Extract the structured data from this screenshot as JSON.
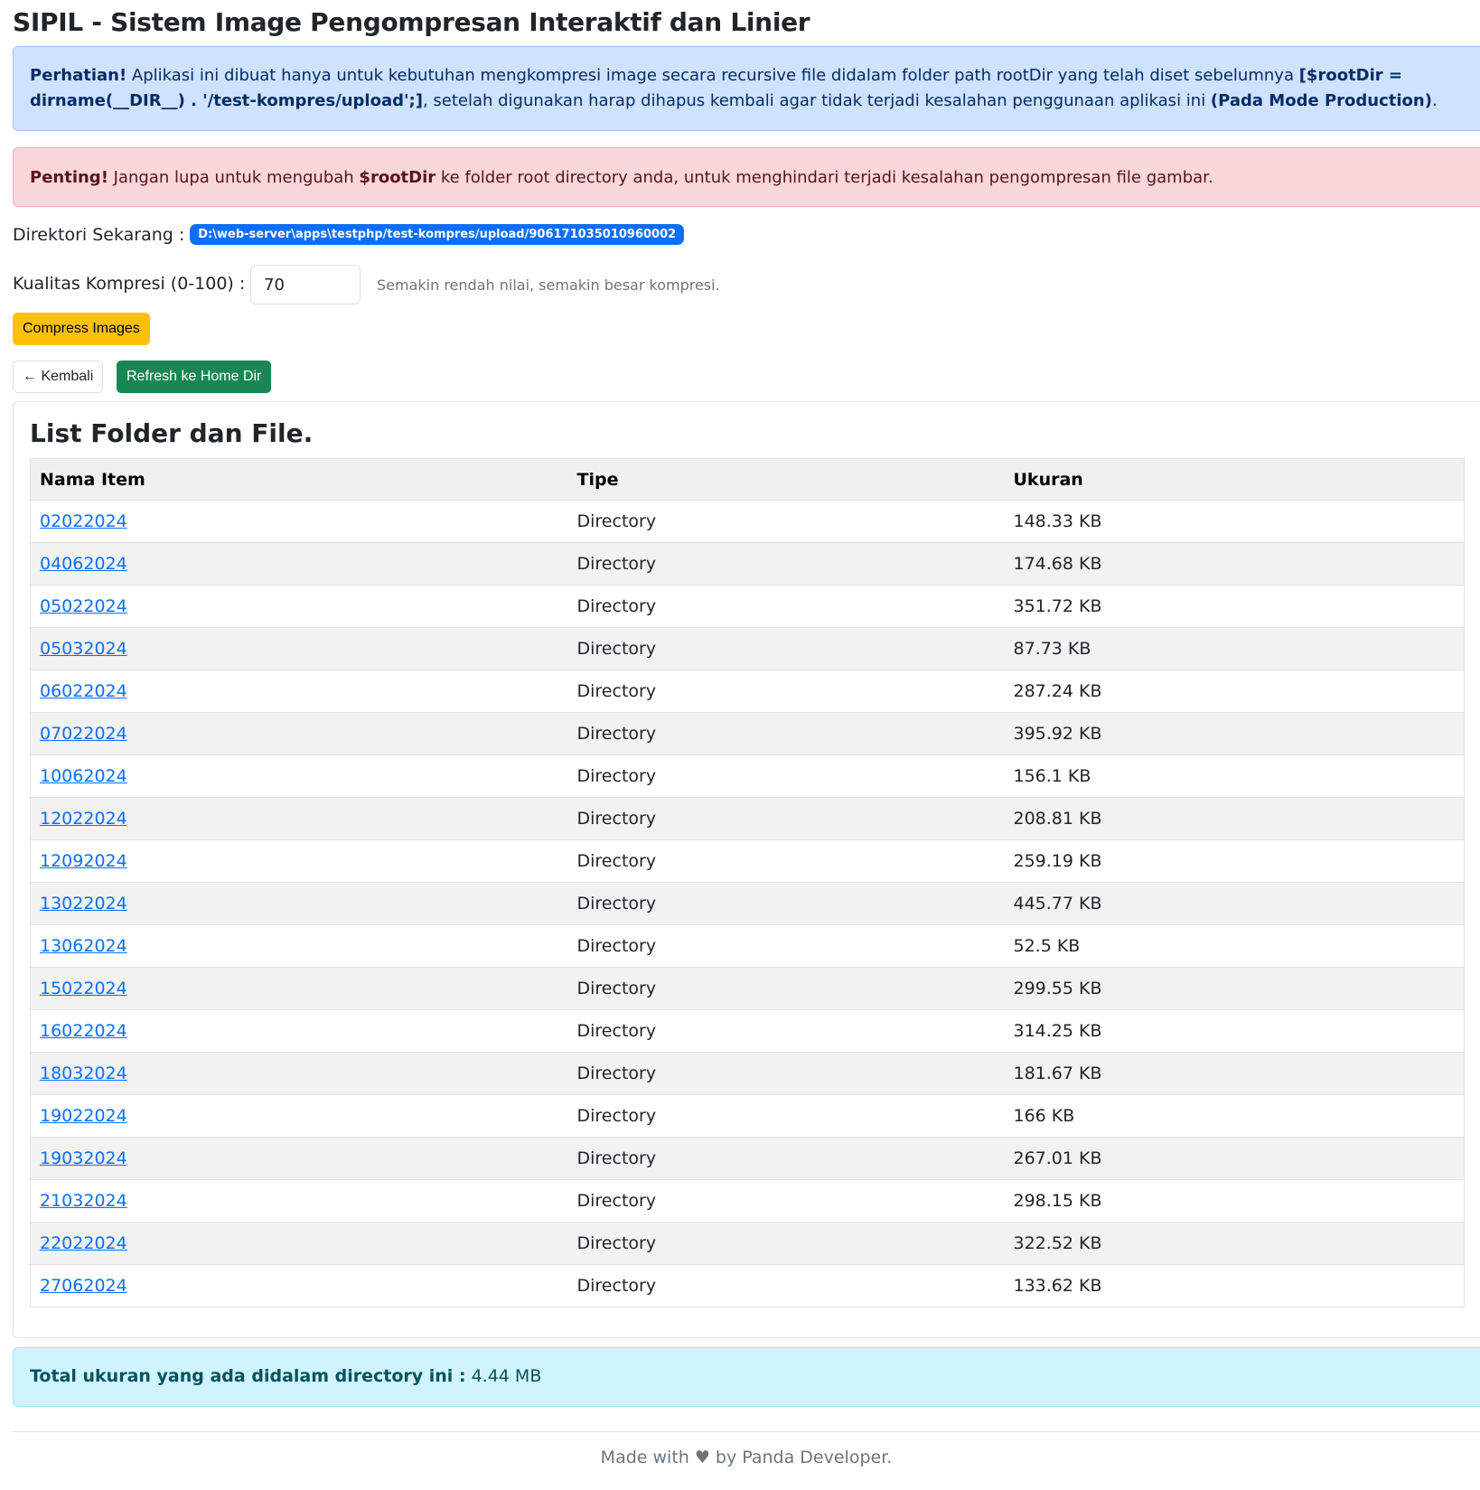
{
  "title": "SIPIL - Sistem Image Pengompresan Interaktif dan Linier",
  "info_alert": {
    "strong": "Perhatian!",
    "text1": " Aplikasi ini dibuat hanya untuk kebutuhan mengkompresi image secara recursive file didalam folder path rootDir yang telah diset sebelumnya ",
    "code": "[$rootDir = dirname(__DIR__) . '/test-kompres/upload';]",
    "text2": ", setelah digunakan harap dihapus kembali agar tidak terjadi kesalahan penggunaan aplikasi ini ",
    "mode": "(Pada Mode Production)",
    "end": "."
  },
  "danger_alert": {
    "strong": "Penting!",
    "text1": " Jangan lupa untuk mengubah ",
    "var": "$rootDir",
    "text2": " ke folder root directory anda, untuk menghindari terjadi kesalahan pengompresan file gambar."
  },
  "current_dir": {
    "label": "Direktori Sekarang :",
    "path": "D:\\web-server\\apps\\testphp/test-kompres/upload/906171035010960002"
  },
  "quality": {
    "label": "Kualitas Kompresi (0-100) :",
    "value": "70",
    "hint": "Semakin rendah nilai, semakin besar kompresi."
  },
  "buttons": {
    "compress": "Compress Images",
    "back": "← Kembali",
    "refresh": "Refresh ke Home Dir"
  },
  "list": {
    "title": "List Folder dan File.",
    "headers": [
      "Nama Item",
      "Tipe",
      "Ukuran"
    ],
    "rows": [
      {
        "name": "02022024",
        "type": "Directory",
        "size": "148.33 KB"
      },
      {
        "name": "04062024",
        "type": "Directory",
        "size": "174.68 KB"
      },
      {
        "name": "05022024",
        "type": "Directory",
        "size": "351.72 KB"
      },
      {
        "name": "05032024",
        "type": "Directory",
        "size": "87.73 KB"
      },
      {
        "name": "06022024",
        "type": "Directory",
        "size": "287.24 KB"
      },
      {
        "name": "07022024",
        "type": "Directory",
        "size": "395.92 KB"
      },
      {
        "name": "10062024",
        "type": "Directory",
        "size": "156.1 KB"
      },
      {
        "name": "12022024",
        "type": "Directory",
        "size": "208.81 KB"
      },
      {
        "name": "12092024",
        "type": "Directory",
        "size": "259.19 KB"
      },
      {
        "name": "13022024",
        "type": "Directory",
        "size": "445.77 KB"
      },
      {
        "name": "13062024",
        "type": "Directory",
        "size": "52.5 KB"
      },
      {
        "name": "15022024",
        "type": "Directory",
        "size": "299.55 KB"
      },
      {
        "name": "16022024",
        "type": "Directory",
        "size": "314.25 KB"
      },
      {
        "name": "18032024",
        "type": "Directory",
        "size": "181.67 KB"
      },
      {
        "name": "19022024",
        "type": "Directory",
        "size": "166 KB"
      },
      {
        "name": "19032024",
        "type": "Directory",
        "size": "267.01 KB"
      },
      {
        "name": "21032024",
        "type": "Directory",
        "size": "298.15 KB"
      },
      {
        "name": "22022024",
        "type": "Directory",
        "size": "322.52 KB"
      },
      {
        "name": "27062024",
        "type": "Directory",
        "size": "133.62 KB"
      }
    ]
  },
  "total": {
    "label": "Total ukuran yang ada didalam directory ini :",
    "value": " 4.44 MB"
  },
  "footer": "Made with ♥ by Panda Developer."
}
